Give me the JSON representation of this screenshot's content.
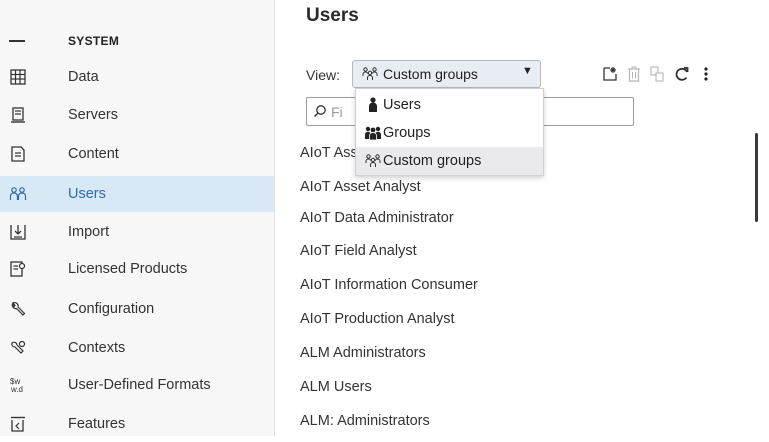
{
  "sidebar": {
    "section_label": "SYSTEM",
    "items": [
      {
        "label": "Data",
        "icon": "table-grid-icon"
      },
      {
        "label": "Servers",
        "icon": "server-icon"
      },
      {
        "label": "Content",
        "icon": "document-icon"
      },
      {
        "label": "Users",
        "icon": "users-group-icon",
        "active": true
      },
      {
        "label": "Import",
        "icon": "import-icon"
      },
      {
        "label": "Licensed Products",
        "icon": "license-icon"
      },
      {
        "label": "Configuration",
        "icon": "wrench-icon"
      },
      {
        "label": "Contexts",
        "icon": "contexts-icon"
      },
      {
        "label": "User-Defined Formats",
        "icon": "format-icon"
      },
      {
        "label": "Features",
        "icon": "features-icon"
      }
    ]
  },
  "main": {
    "title": "Users",
    "view_label": "View:",
    "view_selected": "Custom groups",
    "filter_placeholder": "Fi",
    "toolbar": {
      "new_icon": "new-item-icon",
      "delete_icon": "delete-icon",
      "copy_icon": "copy-icon",
      "refresh_icon": "refresh-icon",
      "more_icon": "more-vertical-icon"
    },
    "list": [
      "AIoT Asset Administrator",
      "AIoT Asset Analyst",
      "AIoT Data Administrator",
      "AIoT Field Analyst",
      "AIoT Information Consumer",
      "AIoT Production Analyst",
      "ALM Administrators",
      "ALM Users",
      "ALM: Administrators"
    ]
  },
  "dropdown": {
    "options": [
      {
        "label": "Users",
        "icon": "user-icon"
      },
      {
        "label": "Groups",
        "icon": "groups-icon"
      },
      {
        "label": "Custom groups",
        "icon": "custom-groups-icon",
        "selected": true
      }
    ]
  },
  "colors": {
    "accent": "#2a6db3",
    "active_row": "#d9e8f5",
    "select_bg": "#e8edf4"
  }
}
